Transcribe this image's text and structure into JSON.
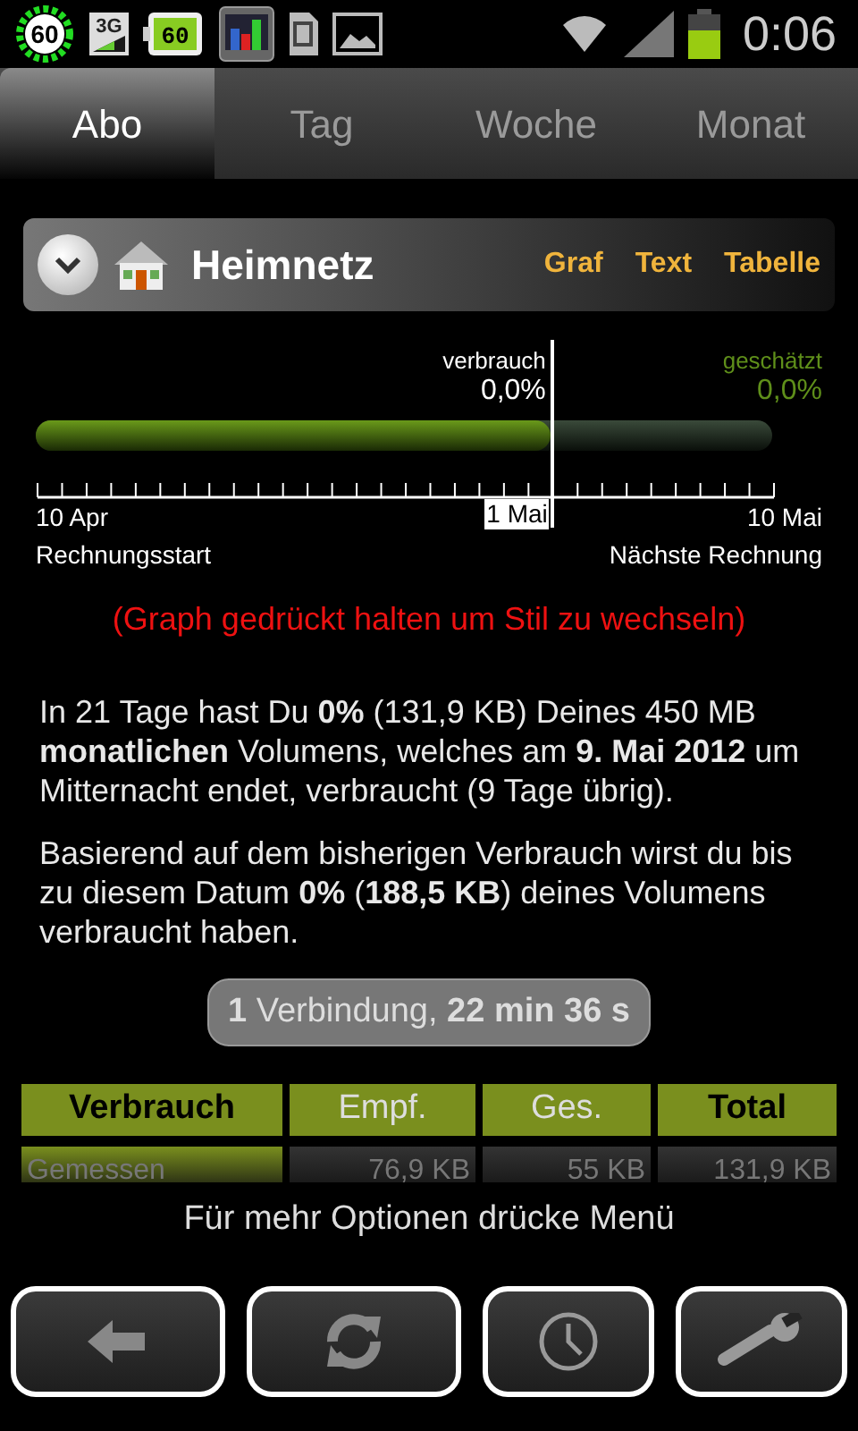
{
  "status_bar": {
    "icons": [
      {
        "kind": "ring",
        "label": "60"
      },
      {
        "kind": "network",
        "label": "3G"
      },
      {
        "kind": "battery-widget",
        "label": "60"
      },
      {
        "kind": "bars"
      },
      {
        "kind": "sim"
      },
      {
        "kind": "image"
      }
    ],
    "time": "0:06"
  },
  "tabs": [
    {
      "label": "Abo",
      "selected": true
    },
    {
      "label": "Tag",
      "selected": false
    },
    {
      "label": "Woche",
      "selected": false
    },
    {
      "label": "Monat",
      "selected": false
    }
  ],
  "header": {
    "title": "Heimnetz",
    "links": [
      "Graf",
      "Text",
      "Tabelle"
    ]
  },
  "usage_bar": {
    "marker_label": "verbrauch",
    "marker_value": "0,0%",
    "estimate_label": "geschätzt",
    "estimate_value": "0,0%",
    "level": 0.7,
    "start_date": "10 Apr",
    "current_date": "1 Mai",
    "end_date": "10 Mai",
    "start_caption": "Rechnungsstart",
    "end_caption": "Nächste Rechnung"
  },
  "hint": "(Graph gedrückt halten um Stil zu wechseln)",
  "paragraphs": [
    "In 21 Tage hast Du **0%** (131,9 KB) Deines 450 MB **monatlichen** Volumens, welches am **9. Mai 2012** um Mitternacht endet, verbraucht (9 Tage übrig).",
    "Basierend auf dem bisherigen Verbrauch wirst du bis zu diesem Datum **0%** (**188,5 KB**) deines Volumens verbraucht haben."
  ],
  "connections": "**1** Verbindung, **22 min 36 s**",
  "table": {
    "columns": [
      {
        "label": "Verbrauch",
        "bold": true
      },
      {
        "label": "Empf.",
        "bold": false
      },
      {
        "label": "Ges.",
        "bold": false
      },
      {
        "label": "Total",
        "bold": true
      }
    ],
    "rows": [
      [
        "Gemessen",
        "76,9 KB",
        "55 KB",
        "131,9 KB"
      ]
    ]
  },
  "menu_hint": "Für mehr Optionen drücke Menü",
  "buttons": [
    {
      "kind": "back"
    },
    {
      "kind": "refresh"
    },
    {
      "kind": "clock"
    },
    {
      "kind": "wrench"
    }
  ]
}
